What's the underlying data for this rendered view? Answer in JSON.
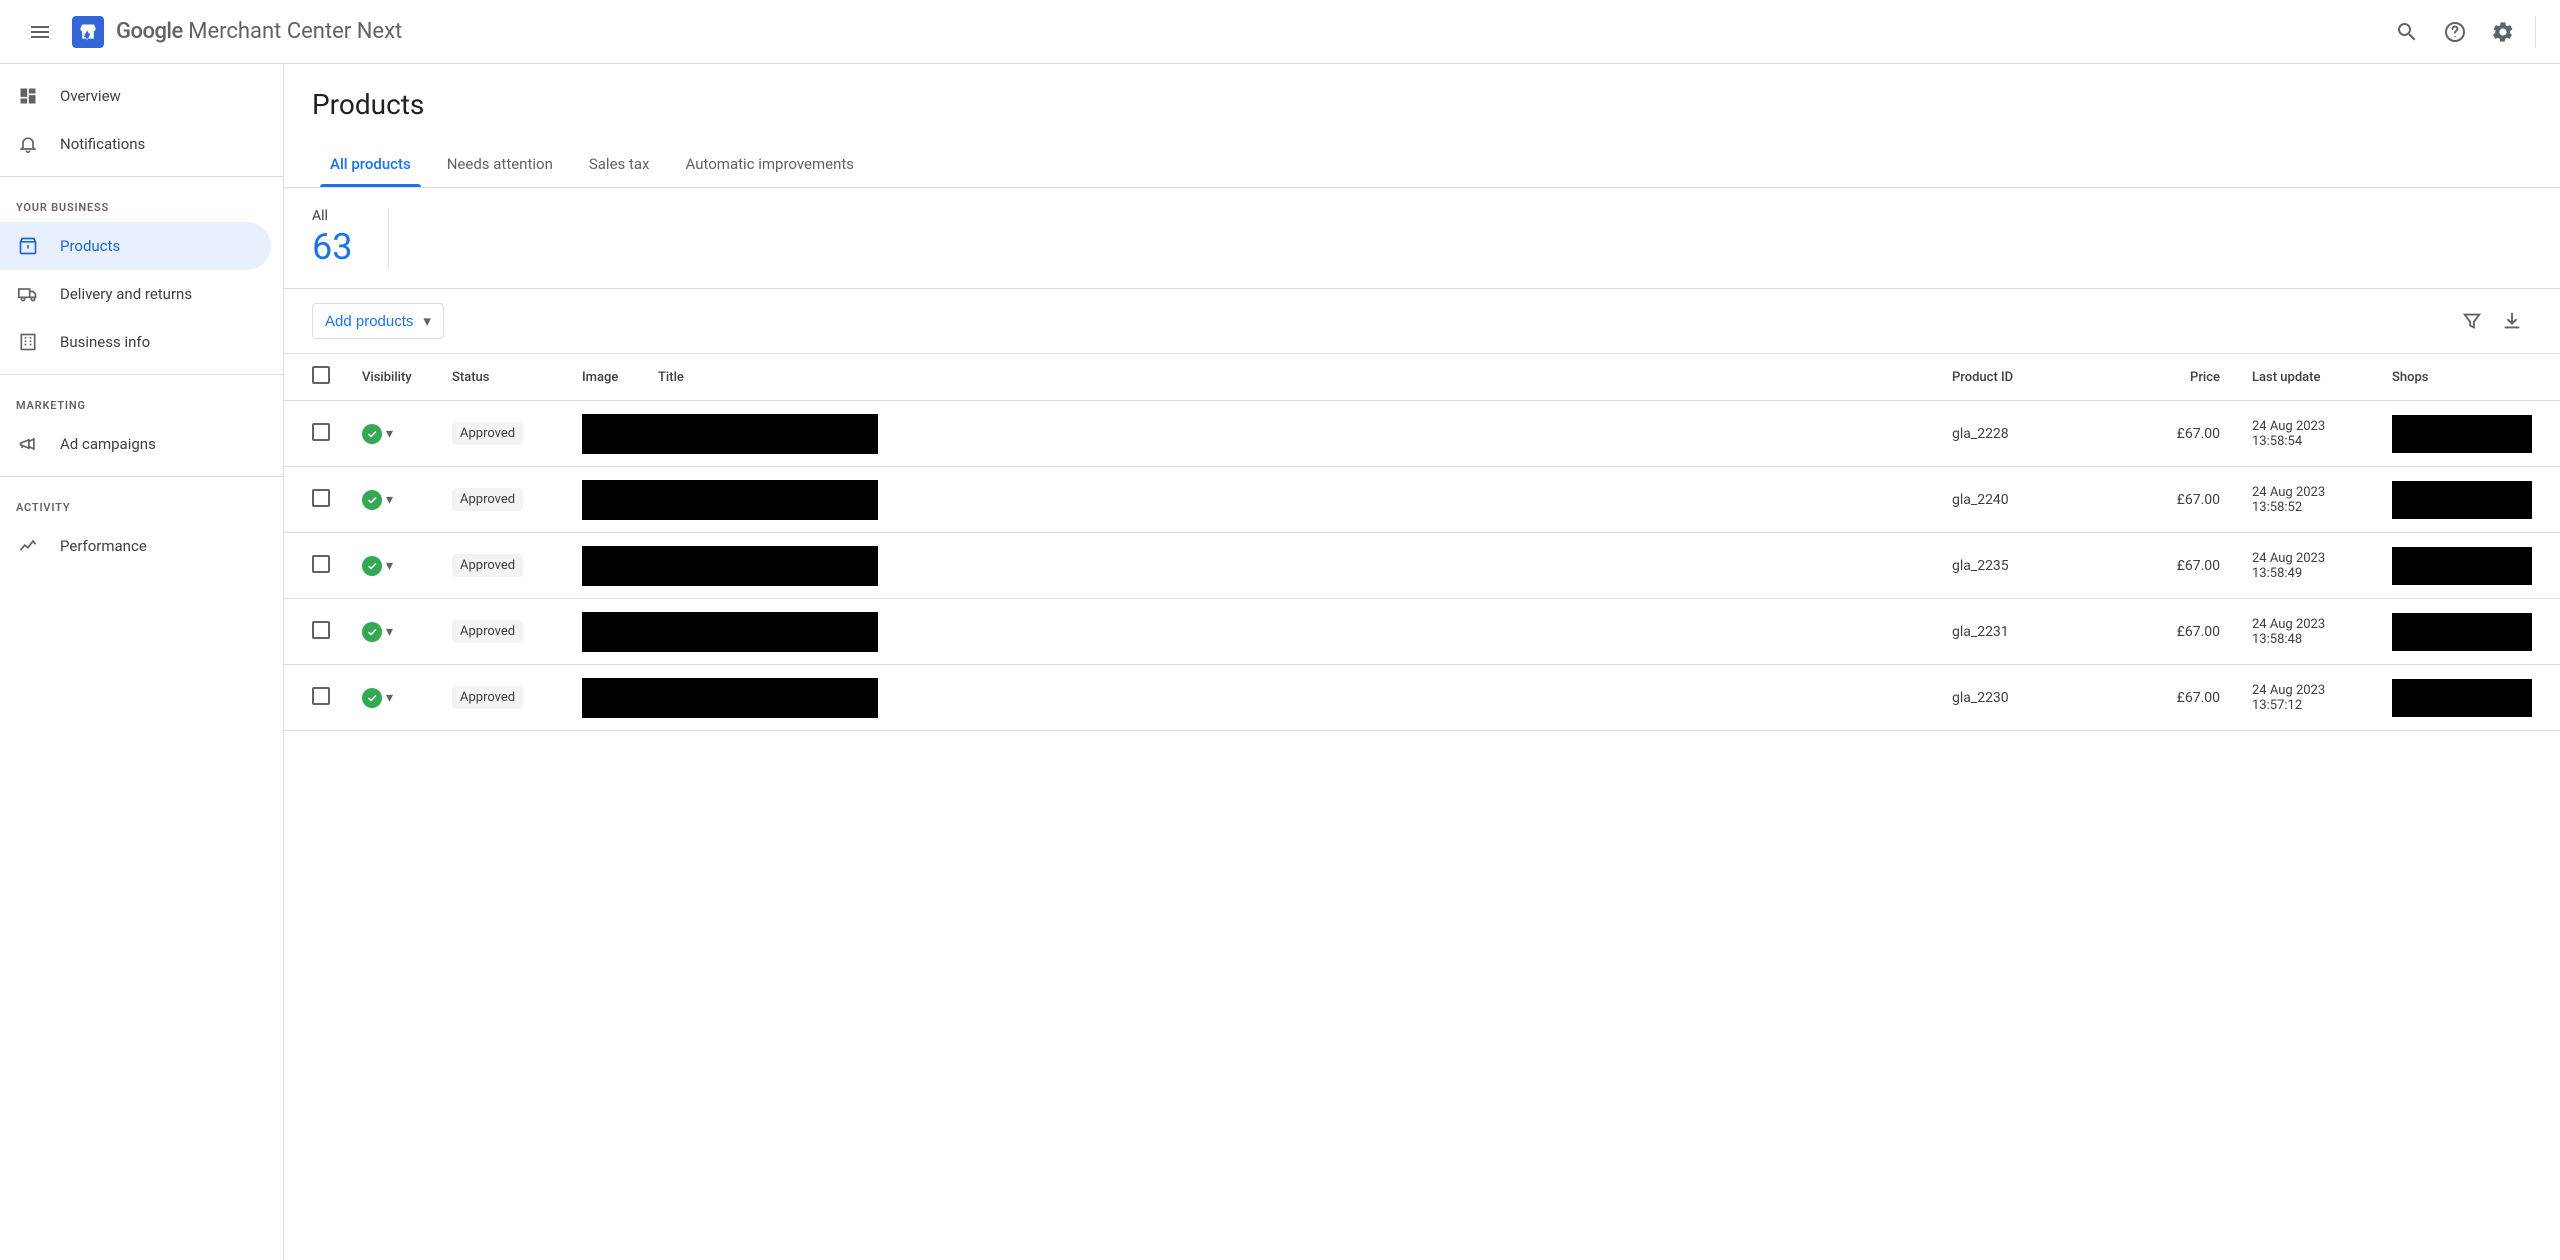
{
  "header": {
    "app_name_google": "Google",
    "app_name_rest": " Merchant Center Next"
  },
  "sidebar": {
    "items": [
      {
        "label": "Overview"
      },
      {
        "label": "Notifications"
      }
    ],
    "section_business": "YOUR BUSINESS",
    "business_items": [
      {
        "label": "Products"
      },
      {
        "label": "Delivery and returns"
      },
      {
        "label": "Business info"
      }
    ],
    "section_marketing": "MARKETING",
    "marketing_items": [
      {
        "label": "Ad campaigns"
      }
    ],
    "section_activity": "ACTIVITY",
    "activity_items": [
      {
        "label": "Performance"
      }
    ]
  },
  "page": {
    "title": "Products",
    "tabs": [
      {
        "label": "All products",
        "active": true
      },
      {
        "label": "Needs attention"
      },
      {
        "label": "Sales tax"
      },
      {
        "label": "Automatic improvements"
      }
    ],
    "stat_label": "All",
    "stat_value": "63",
    "add_button": "Add products"
  },
  "table": {
    "headers": {
      "visibility": "Visibility",
      "status": "Status",
      "image": "Image",
      "title": "Title",
      "product_id": "Product ID",
      "price": "Price",
      "last_update": "Last update",
      "shops": "Shops"
    },
    "rows": [
      {
        "status": "Approved",
        "product_id": "gla_2228",
        "price": "£67.00",
        "date": "24 Aug 2023",
        "time": "13:58:54"
      },
      {
        "status": "Approved",
        "product_id": "gla_2240",
        "price": "£67.00",
        "date": "24 Aug 2023",
        "time": "13:58:52"
      },
      {
        "status": "Approved",
        "product_id": "gla_2235",
        "price": "£67.00",
        "date": "24 Aug 2023",
        "time": "13:58:49"
      },
      {
        "status": "Approved",
        "product_id": "gla_2231",
        "price": "£67.00",
        "date": "24 Aug 2023",
        "time": "13:58:48"
      },
      {
        "status": "Approved",
        "product_id": "gla_2230",
        "price": "£67.00",
        "date": "24 Aug 2023",
        "time": "13:57:12"
      }
    ]
  }
}
